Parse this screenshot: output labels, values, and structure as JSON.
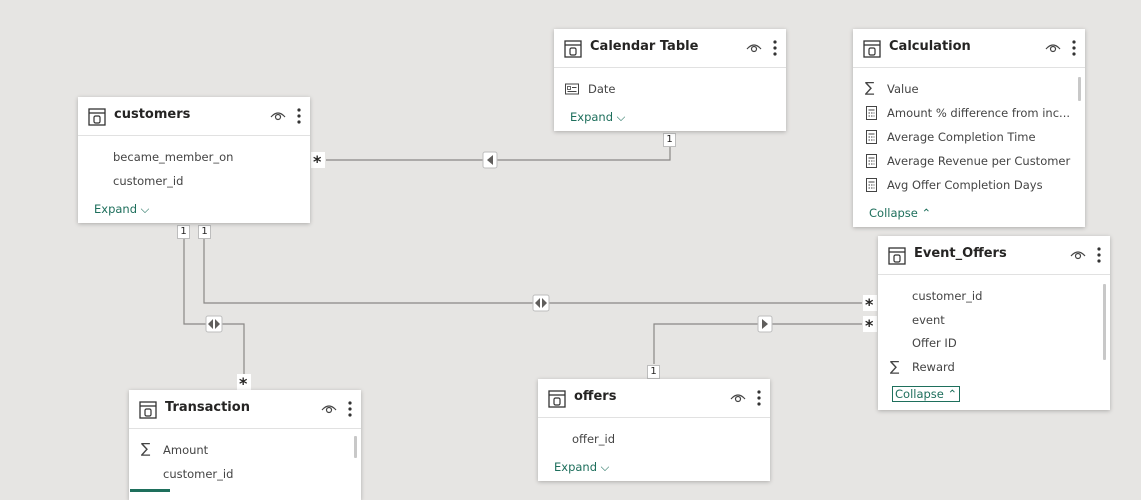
{
  "tables": {
    "customers": {
      "title": "customers",
      "fields": [
        "became_member_on",
        "customer_id"
      ],
      "toggle": "Expand"
    },
    "calendar": {
      "title": "Calendar Table",
      "fields": [
        "Date"
      ],
      "toggle": "Expand"
    },
    "calculation": {
      "title": "Calculation",
      "fields": [
        "Value",
        "Amount % difference from inc...",
        "Average Completion Time",
        "Average Revenue per Customer",
        "Avg Offer Completion Days"
      ],
      "toggle": "Collapse"
    },
    "event_offers": {
      "title": "Event_Offers",
      "fields": [
        "customer_id",
        "event",
        "Offer ID",
        "Reward"
      ],
      "toggle": "Collapse"
    },
    "transaction": {
      "title": "Transaction",
      "fields": [
        "Amount",
        "customer_id"
      ]
    },
    "offers": {
      "title": "offers",
      "fields": [
        "offer_id"
      ],
      "toggle": "Expand"
    }
  },
  "relationships": {
    "one": "1",
    "many": "*"
  },
  "icons": {
    "table": "table-icon",
    "eye": "eye-icon",
    "more": "more-options-icon",
    "sigma": "sigma-icon",
    "measure": "calculator-icon",
    "date": "date-field-icon"
  },
  "colors": {
    "canvas": "#e6e5e3",
    "accent": "#1e6f5c",
    "line": "#8a8886"
  }
}
